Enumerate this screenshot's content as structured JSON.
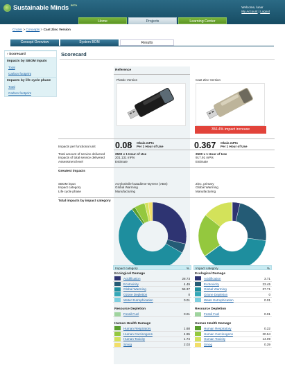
{
  "header": {
    "app": "Sustainable Minds",
    "beta": "BETA",
    "welcome": "Welcome, lunar",
    "my_account": "My Account",
    "logout": "Logout"
  },
  "nav": {
    "tabs": [
      {
        "label": "Home"
      },
      {
        "label": "Projects"
      },
      {
        "label": "Learning Center"
      }
    ]
  },
  "breadcrumb": {
    "items": [
      "Cruzer",
      "Concepts"
    ],
    "current": "Cast Zinc Version"
  },
  "subtabs": [
    {
      "label": "Concept Overview"
    },
    {
      "label": "System BOM"
    },
    {
      "label": "Results"
    }
  ],
  "sidebar": {
    "scorecard": "Scorecard",
    "by_sbom": "Impacts by SBOM inputs",
    "total": "Total",
    "carbon": "Carbon footprint",
    "by_lifecycle": "Impacts by life cycle phase"
  },
  "scorecard": {
    "title": "Scorecard",
    "reference_label": "Reference",
    "ref_name": "Plastic Version",
    "cmp_name": "Cast Zinc Version",
    "impact_badge": "356.4% impact increase",
    "row_labels": [
      "Impacts per functional unit",
      "Total amount of service delivered",
      "Impacts of total service delivered",
      "Assessment level"
    ],
    "ref": {
      "value": "0.08",
      "unit1": "Okala mPts",
      "unit2": "Per 1 Hour of Use",
      "service": "2500 x 1 Hour of Use",
      "total": "201.131 mPts",
      "assessment": "Estimate"
    },
    "cmp": {
      "value": "0.367",
      "unit1": "Okala mPts",
      "unit2": "Per 1 Hour of Use",
      "service": "2500 x 1 Hour of Use",
      "total": "917.91 mPts",
      "assessment": "Estimate"
    },
    "greatest_label": "Greatest impacts",
    "greatest_labels": [
      "SBOM input",
      "Impact category",
      "Life cycle phase"
    ],
    "ref_greatest": [
      "Acrylonitrile-butadiene-styrene (ABS)",
      "Global Warming",
      "Manufacturing"
    ],
    "cmp_greatest": [
      "Zinc, primary",
      "Global Warming",
      "Manufacturing"
    ],
    "total_by_category": "Total impacts by impact category"
  },
  "legend": {
    "col_cat": "Impact category",
    "col_pct": "%",
    "groups": [
      {
        "name": "Ecological Damage",
        "items": [
          {
            "label": "Acidification",
            "color": "#2e3472",
            "ref": "28.73",
            "cmp": "3.71"
          },
          {
            "label": "Ecotoxicity",
            "color": "#245b75",
            "ref": "4.49",
            "cmp": "23.45"
          },
          {
            "label": "Global Warming",
            "color": "#1e8e9e",
            "ref": "56.37",
            "cmp": "37.71"
          },
          {
            "label": "Ozone Depletion",
            "color": "#35a8b8",
            "ref": "0",
            "cmp": "0"
          },
          {
            "label": "Water Eutrophication",
            "color": "#7ccfe0",
            "ref": "0.01",
            "cmp": "0.01"
          }
        ]
      },
      {
        "name": "Resource Depletion",
        "items": [
          {
            "label": "Fossil Fuel",
            "color": "#9fd49e",
            "ref": "0.01",
            "cmp": "0.01"
          }
        ]
      },
      {
        "name": "Human Health Damage",
        "items": [
          {
            "label": "Human Respiratory",
            "color": "#5a9e2e",
            "ref": "1.68",
            "cmp": "0.22"
          },
          {
            "label": "Human Carcinogens",
            "color": "#94c83e",
            "ref": "4.95",
            "cmp": "20.54"
          },
          {
            "label": "Human Toxicity",
            "color": "#d3e25a",
            "ref": "1.74",
            "cmp": "14.09"
          },
          {
            "label": "Smog",
            "color": "#f2de6a",
            "ref": "2.03",
            "cmp": "0.29"
          }
        ]
      }
    ]
  }
}
